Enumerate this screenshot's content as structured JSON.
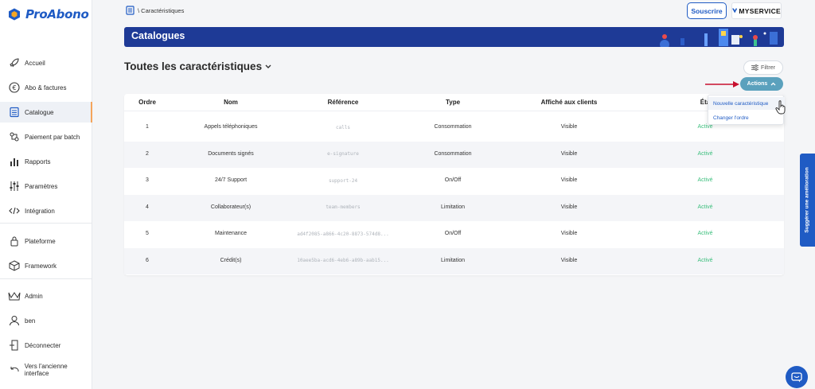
{
  "app": {
    "name": "ProAbono"
  },
  "sidebar": {
    "items": [
      {
        "label": "Accueil",
        "icon": "rocket-icon"
      },
      {
        "label": "Abo & factures",
        "icon": "euro-icon"
      },
      {
        "label": "Catalogue",
        "icon": "catalog-icon"
      },
      {
        "label": "Paiement par batch",
        "icon": "batch-icon"
      },
      {
        "label": "Rapports",
        "icon": "chart-icon"
      },
      {
        "label": "Paramètres",
        "icon": "sliders-icon"
      },
      {
        "label": "Intégration",
        "icon": "code-icon"
      },
      {
        "label": "Plateforme",
        "icon": "lock-icon"
      },
      {
        "label": "Framework",
        "icon": "cube-icon"
      },
      {
        "label": "Admin",
        "icon": "crown-icon"
      },
      {
        "label": "ben",
        "icon": "user-icon"
      },
      {
        "label": "Déconnecter",
        "icon": "logout-icon"
      },
      {
        "label": "Vers l'ancienne interface",
        "icon": "back-icon"
      }
    ]
  },
  "topbar": {
    "breadcrumb": "\\ Caractéristiques",
    "subscribe_label": "Souscrire",
    "service_name": "MYSERVICE"
  },
  "banner": {
    "title": "Catalogues"
  },
  "page": {
    "title": "Toutes les caractéristiques",
    "filter_label": "Filtrer",
    "actions_label": "Actions"
  },
  "dropdown": {
    "items": [
      "Nouvelle caractéristique",
      "Changer l'ordre"
    ]
  },
  "table": {
    "headers": [
      "Ordre",
      "Nom",
      "Référence",
      "Type",
      "Affiché aux clients",
      "Éta"
    ],
    "rows": [
      {
        "order": "1",
        "name": "Appels téléphoniques",
        "ref": "calls",
        "type": "Consommation",
        "visibility": "Visible",
        "status": "Activé"
      },
      {
        "order": "2",
        "name": "Documents signés",
        "ref": "e-signature",
        "type": "Consommation",
        "visibility": "Visible",
        "status": "Activé"
      },
      {
        "order": "3",
        "name": "24/7 Support",
        "ref": "support-24",
        "type": "On/Off",
        "visibility": "Visible",
        "status": "Activé"
      },
      {
        "order": "4",
        "name": "Collaborateur(s)",
        "ref": "team-members",
        "type": "Limitation",
        "visibility": "Visible",
        "status": "Activé"
      },
      {
        "order": "5",
        "name": "Maintenance",
        "ref": "ad4f2085-a866-4c20-8873-574d8...",
        "type": "On/Off",
        "visibility": "Visible",
        "status": "Activé"
      },
      {
        "order": "6",
        "name": "Crédit(s)",
        "ref": "10aee5ba-acd6-4eb6-a89b-aab15...",
        "type": "Limitation",
        "visibility": "Visible",
        "status": "Activé"
      }
    ]
  },
  "feedback": {
    "label": "Suggérer une amélioration"
  },
  "colors": {
    "primary": "#1f5bc4",
    "banner": "#1e3a96",
    "actions": "#5ba1bd",
    "active_status": "#3cbf7d",
    "arrow": "#c8102e"
  }
}
